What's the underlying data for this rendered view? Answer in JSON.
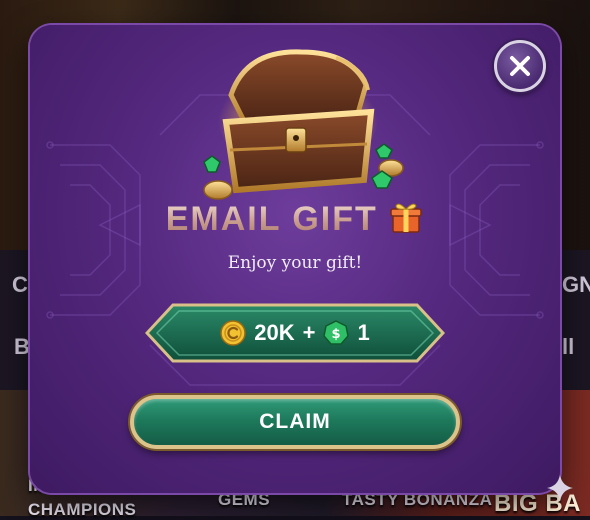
{
  "background": {
    "side_text_left": "C",
    "side_text_left2": "B",
    "side_text_right": "GN",
    "side_text_right2": "ll",
    "tiles": [
      {
        "label": "IMMORTAL WAYS"
      },
      {
        "label": "CHAMPIONS"
      },
      {
        "label": "GEMS"
      },
      {
        "label": "TASTY BONANZA"
      },
      {
        "label": "BIG BA"
      }
    ]
  },
  "modal": {
    "title": "EMAIL GIFT",
    "subtitle": "Enjoy your gift!",
    "reward": {
      "coins": "20K",
      "plus": "+",
      "sweeps": "1"
    },
    "claim_label": "CLAIM"
  },
  "colors": {
    "modal_bg": "#54287e",
    "claim_green": "#1e7a5c",
    "gold_border": "#dcc38a"
  },
  "icons": [
    "close-icon",
    "treasure-chest-icon",
    "gift-icon",
    "coin-icon",
    "sweeps-coin-icon",
    "sparkle-icon"
  ]
}
